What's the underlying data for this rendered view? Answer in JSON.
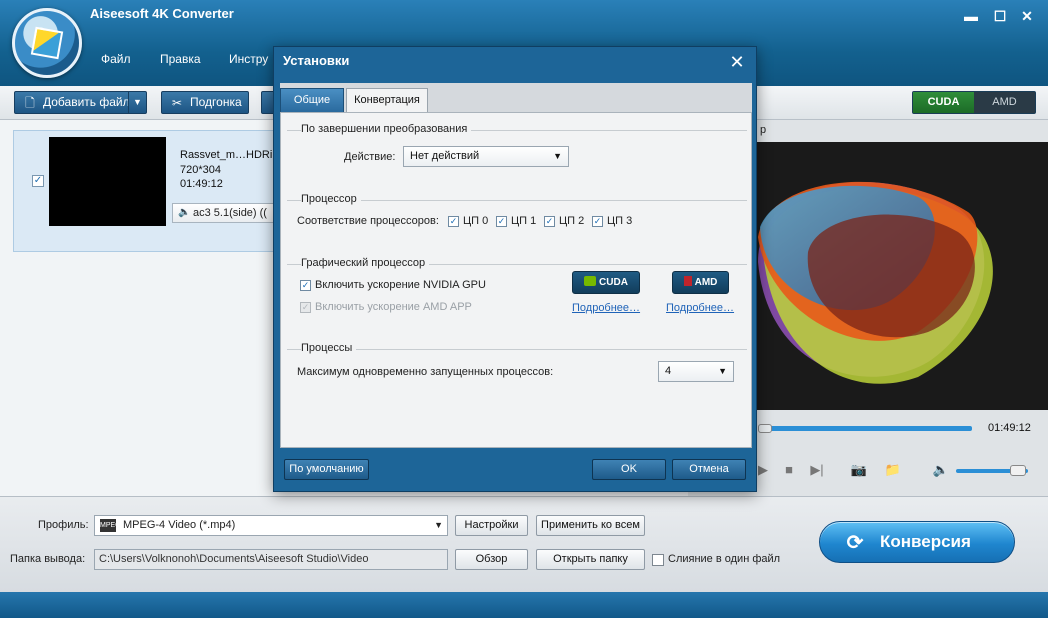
{
  "window": {
    "title": "Aiseesoft 4K Converter",
    "menu": [
      "Файл",
      "Правка",
      "Инстру"
    ],
    "controls": {
      "minimize": "▬",
      "maximize": "☐",
      "close": "✕"
    }
  },
  "toolbar": {
    "add_file": "Добавить файл",
    "trim": "Подгонка",
    "gpu_cuda": "CUDA",
    "gpu_amd": "AMD"
  },
  "file": {
    "name": "Rassvet_m…HDRip",
    "resolution": "720*304",
    "duration": "01:49:12",
    "audio": "ac3 5.1(side) (("
  },
  "preview": {
    "label": "р",
    "time": "01:49:12",
    "playback_position": 0.0
  },
  "bottom": {
    "profile_label": "Профиль:",
    "profile_value": "MPEG-4 Video (*.mp4)",
    "profile_icon_text": "MPEG",
    "settings_button": "Настройки",
    "apply_all_button": "Применить ко всем",
    "output_label": "Папка вывода:",
    "output_path": "C:\\Users\\Volknonoh\\Documents\\Aiseesoft Studio\\Video",
    "browse_button": "Обзор",
    "open_folder_button": "Открыть папку",
    "merge_label": "Слияние в один файл",
    "merge_checked": false,
    "convert_button": "Конверсия"
  },
  "dialog": {
    "title": "Установки",
    "tabs": [
      "Общие",
      "Конвертация"
    ],
    "active_tab": "Конвертация",
    "on_finish": {
      "section": "По завершении преобразования",
      "action_label": "Действие:",
      "action_value": "Нет действий"
    },
    "processor": {
      "section": "Процессор",
      "affinity_label": "Соответствие процессоров:",
      "cpus": [
        {
          "label": "ЦП 0",
          "checked": true
        },
        {
          "label": "ЦП 1",
          "checked": true
        },
        {
          "label": "ЦП 2",
          "checked": true
        },
        {
          "label": "ЦП 3",
          "checked": true
        }
      ]
    },
    "gpu": {
      "section": "Графический процессор",
      "nvidia_label": "Включить ускорение NVIDIA GPU",
      "nvidia_checked": true,
      "amd_label": "Включить ускорение AMD APP",
      "amd_enabled": false,
      "cuda_button": "CUDA",
      "amd_button": "AMD",
      "more_cuda": "Подробнее…",
      "more_amd": "Подробнее…"
    },
    "processes": {
      "section": "Процессы",
      "max_label": "Максимум одновременно запущенных процессов:",
      "max_value": "4"
    },
    "buttons": {
      "defaults": "По умолчанию",
      "ok": "OK",
      "cancel": "Отмена"
    }
  },
  "colors": {
    "accent": "#1d6598",
    "convert": "#1f86cf",
    "link": "#1f63b8"
  }
}
